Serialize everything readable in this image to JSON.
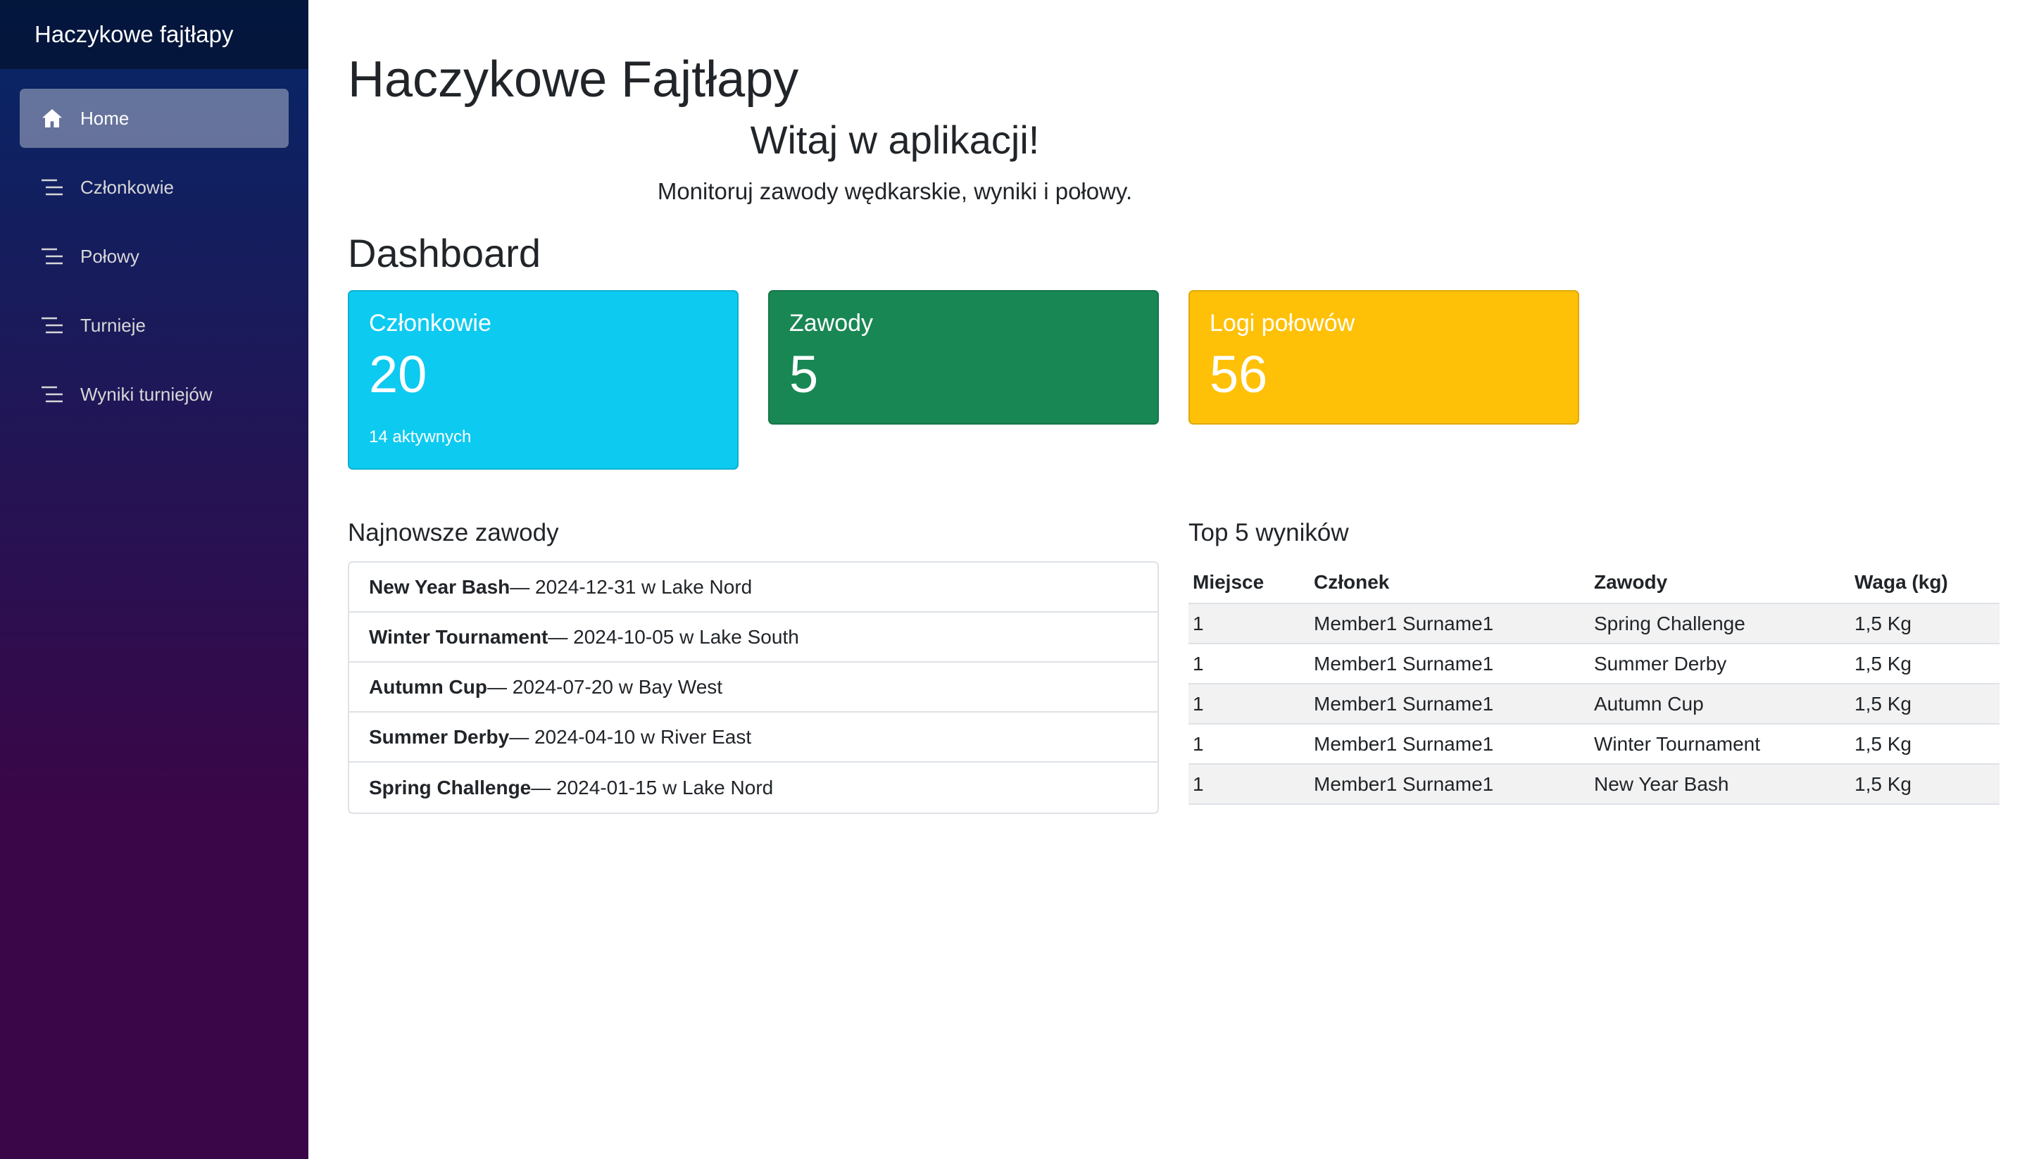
{
  "app": {
    "brand": "Haczykowe fajtłapy"
  },
  "sidebar": {
    "items": [
      {
        "label": "Home",
        "icon": "home-icon",
        "active": true
      },
      {
        "label": "Członkowie",
        "icon": "list-icon"
      },
      {
        "label": "Połowy",
        "icon": "list-icon"
      },
      {
        "label": "Turnieje",
        "icon": "list-icon"
      },
      {
        "label": "Wyniki turniejów",
        "icon": "list-icon"
      }
    ]
  },
  "main": {
    "title": "Haczykowe Fajtłapy",
    "welcome": "Witaj w aplikacji!",
    "subtitle": "Monitoruj zawody wędkarskie, wyniki i połowy.",
    "dashboard_title": "Dashboard"
  },
  "cards": [
    {
      "title": "Członkowie",
      "value": "20",
      "note": "14 aktywnych",
      "color": "#0dcaf0"
    },
    {
      "title": "Zawody",
      "value": "5",
      "color": "#198754"
    },
    {
      "title": "Logi połowów",
      "value": "56",
      "color": "#ffc107"
    }
  ],
  "latest_contests": {
    "title": "Najnowsze zawody",
    "items": [
      {
        "name": "New Year Bash",
        "details": " — 2024-12-31 w Lake Nord"
      },
      {
        "name": "Winter Tournament",
        "details": " — 2024-10-05 w Lake South"
      },
      {
        "name": "Autumn Cup",
        "details": " — 2024-07-20 w Bay West"
      },
      {
        "name": "Summer Derby",
        "details": " — 2024-04-10 w River East"
      },
      {
        "name": "Spring Challenge",
        "details": " — 2024-01-15 w Lake Nord"
      }
    ]
  },
  "top_results": {
    "title": "Top 5 wyników",
    "headers": [
      "Miejsce",
      "Członek",
      "Zawody",
      "Waga (kg)"
    ],
    "rows": [
      [
        "1",
        "Member1 Surname1",
        "Spring Challenge",
        "1,5 Kg"
      ],
      [
        "1",
        "Member1 Surname1",
        "Summer Derby",
        "1,5 Kg"
      ],
      [
        "1",
        "Member1 Surname1",
        "Autumn Cup",
        "1,5 Kg"
      ],
      [
        "1",
        "Member1 Surname1",
        "Winter Tournament",
        "1,5 Kg"
      ],
      [
        "1",
        "Member1 Surname1",
        "New Year Bash",
        "1,5 Kg"
      ]
    ]
  }
}
